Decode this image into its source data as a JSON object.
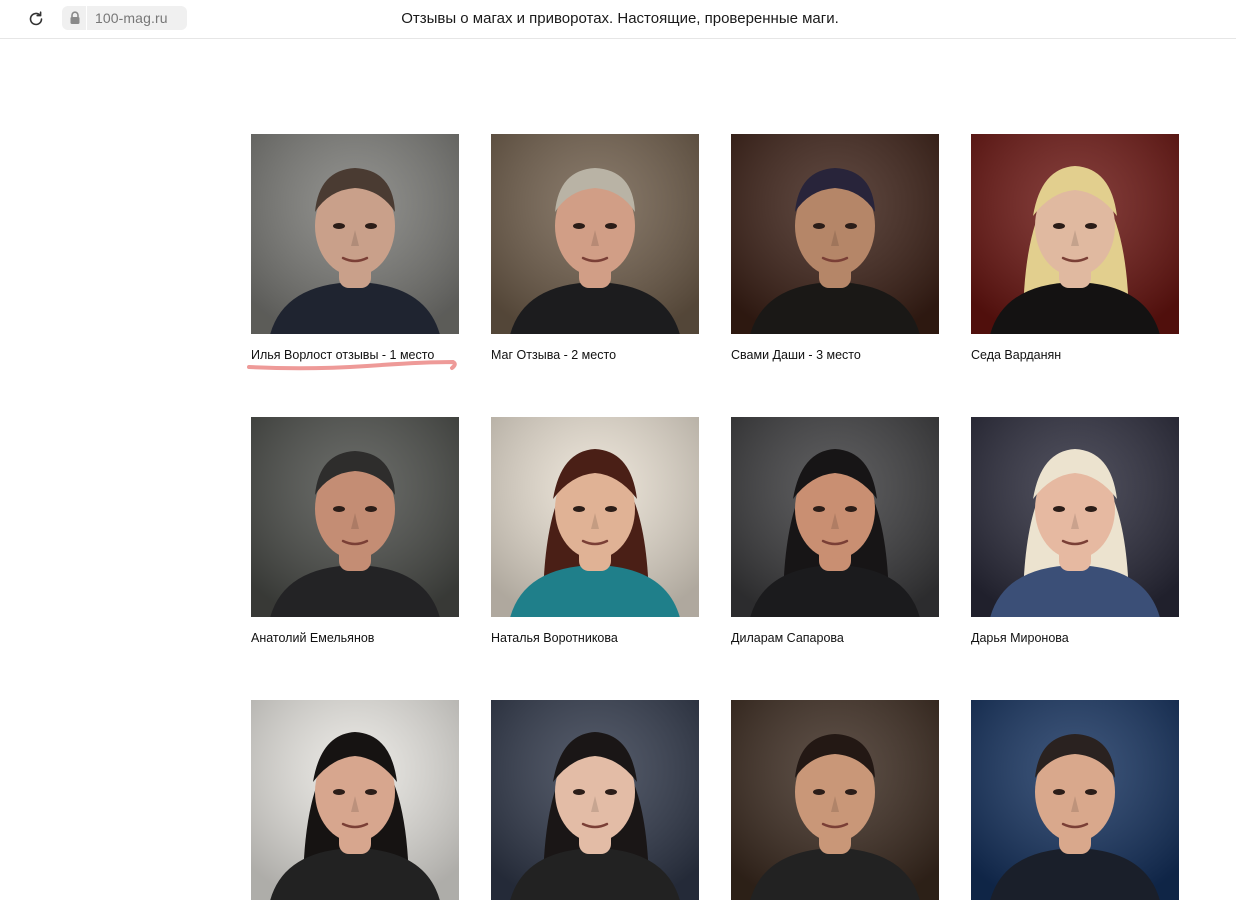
{
  "browser": {
    "url": "100-mag.ru",
    "title": "Отзывы о магах и приворотах. Настоящие, проверенные маги."
  },
  "cards": [
    {
      "caption": "Илья Ворлост отзывы - 1 место",
      "bg": "#7a7a76",
      "skin": "#c9a08a",
      "hair": "#4a3b32",
      "cloth": "#1f2430"
    },
    {
      "caption": "Маг Отзыва - 2 место",
      "bg": "#6f5d4a",
      "skin": "#d19e86",
      "hair": "#b9b3a5",
      "cloth": "#1c1c1e"
    },
    {
      "caption": "Свами Даши - 3 место",
      "bg": "#3c2016",
      "skin": "#b58668",
      "hair": "#28243a",
      "cloth": "#1a1816"
    },
    {
      "caption": "Седа Варданян",
      "bg": "#6a1410",
      "skin": "#e0b9a0",
      "hair": "#e2cf8e",
      "cloth": "#141212"
    },
    {
      "caption": "Анатолий Емельянов",
      "bg": "#4a4c48",
      "skin": "#c48d74",
      "hair": "#2e2d2c",
      "cloth": "#232325"
    },
    {
      "caption": "Наталья Воротникова",
      "bg": "#e9e0d2",
      "skin": "#e0b295",
      "hair": "#4a1f16",
      "cloth": "#1f7f8a"
    },
    {
      "caption": "Диларам Сапарова",
      "bg": "#3b3b3d",
      "skin": "#c98f72",
      "hair": "#171516",
      "cloth": "#1b1b1d"
    },
    {
      "caption": "Дарья Миронова",
      "bg": "#2a2a3a",
      "skin": "#e6b9a1",
      "hair": "#ece3cf",
      "cloth": "#3b4f77"
    },
    {
      "caption": "",
      "bg": "#e8e6e1",
      "skin": "#d7a68e",
      "hair": "#161312",
      "cloth": "#222"
    },
    {
      "caption": "",
      "bg": "#30384a",
      "skin": "#e3bca6",
      "hair": "#1a1616",
      "cloth": "#222"
    },
    {
      "caption": "",
      "bg": "#3b2a1f",
      "skin": "#c99778",
      "hair": "#231814",
      "cloth": "#222"
    },
    {
      "caption": "",
      "bg": "#14315e",
      "skin": "#d9a88c",
      "hair": "#2a2220",
      "cloth": "#1a1f2a"
    }
  ]
}
